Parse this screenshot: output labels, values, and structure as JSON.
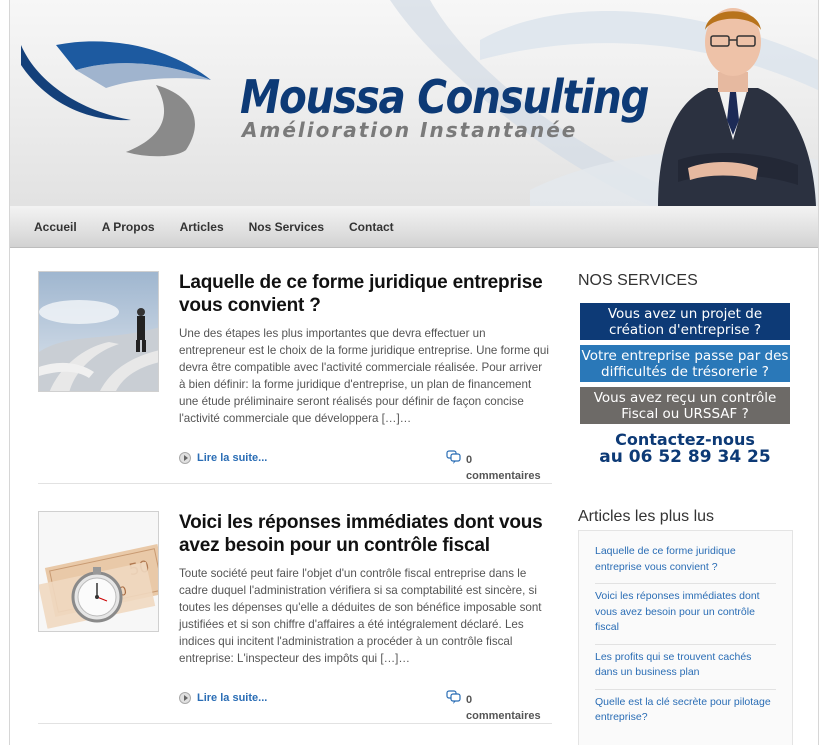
{
  "header": {
    "brand_name": "Moussa Consulting",
    "tagline": "Amélioration Instantanée"
  },
  "nav": {
    "items": [
      {
        "label": "Accueil"
      },
      {
        "label": "A Propos"
      },
      {
        "label": "Articles"
      },
      {
        "label": "Nos Services"
      },
      {
        "label": "Contact"
      }
    ]
  },
  "posts": [
    {
      "title": "Laquelle de ce forme juridique entreprise vous convient ?",
      "excerpt": "Une des étapes les plus importantes que devra effectuer un entrepreneur est le choix de la forme juridique  entreprise. Une forme qui devra être compatible avec l'activité commerciale réalisée. Pour arriver à bien définir: la forme juridique d'entreprise, un plan de financement une étude préliminaire seront réalisés pour définir de façon concise l'activité commerciale que développera […]…",
      "read_more": "Lire la suite...",
      "comment_count": "0",
      "comment_label": "commentaires",
      "thumb_icon": "business-crossroads-image"
    },
    {
      "title": "Voici les réponses immédiates dont vous avez besoin pour un contrôle fiscal",
      "excerpt": "Toute société peut faire l'objet d'un contrôle fiscal entreprise dans le cadre duquel l'administration vérifiera si sa comptabilité est sincère, si toutes les dépenses qu'elle a déduites de son bénéfice imposable sont justifiées et si son chiffre d'affaires a été intégralement déclaré. Les indices qui incitent l'administration a procéder à un contrôle fiscal entreprise: L'inspecteur des impôts qui […]…",
      "read_more": "Lire la suite...",
      "comment_count": "0",
      "comment_label": "commentaires",
      "thumb_icon": "stopwatch-banknotes-image"
    }
  ],
  "sidebar": {
    "services_heading": "NOS SERVICES",
    "services": [
      {
        "label": "Vous avez un projet de création d'entreprise ?",
        "color": "#0d3a76"
      },
      {
        "label": "Votre entreprise passe par des difficultés de trésorerie ?",
        "color": "#2a78b8"
      },
      {
        "label": "Vous avez reçu un contrôle Fiscal ou URSSAF ?",
        "color": "#6d6a67"
      }
    ],
    "contact_line1": "Contactez-nous",
    "contact_line2": "au 06 52 89 34 25",
    "popular_heading": "Articles les plus lus",
    "popular": [
      {
        "label": "Laquelle de ce forme juridique entreprise vous convient ?"
      },
      {
        "label": "Voici les réponses immédiates dont vous avez besoin pour un contrôle fiscal"
      },
      {
        "label": "Les profits qui se trouvent cachés dans un business plan"
      },
      {
        "label": "Quelle est la clé secrète pour pilotage entreprise?"
      }
    ]
  },
  "colors": {
    "brand_blue": "#0d3a76",
    "link_blue": "#2a6db5",
    "tagline_gray": "#7a7a7a"
  }
}
